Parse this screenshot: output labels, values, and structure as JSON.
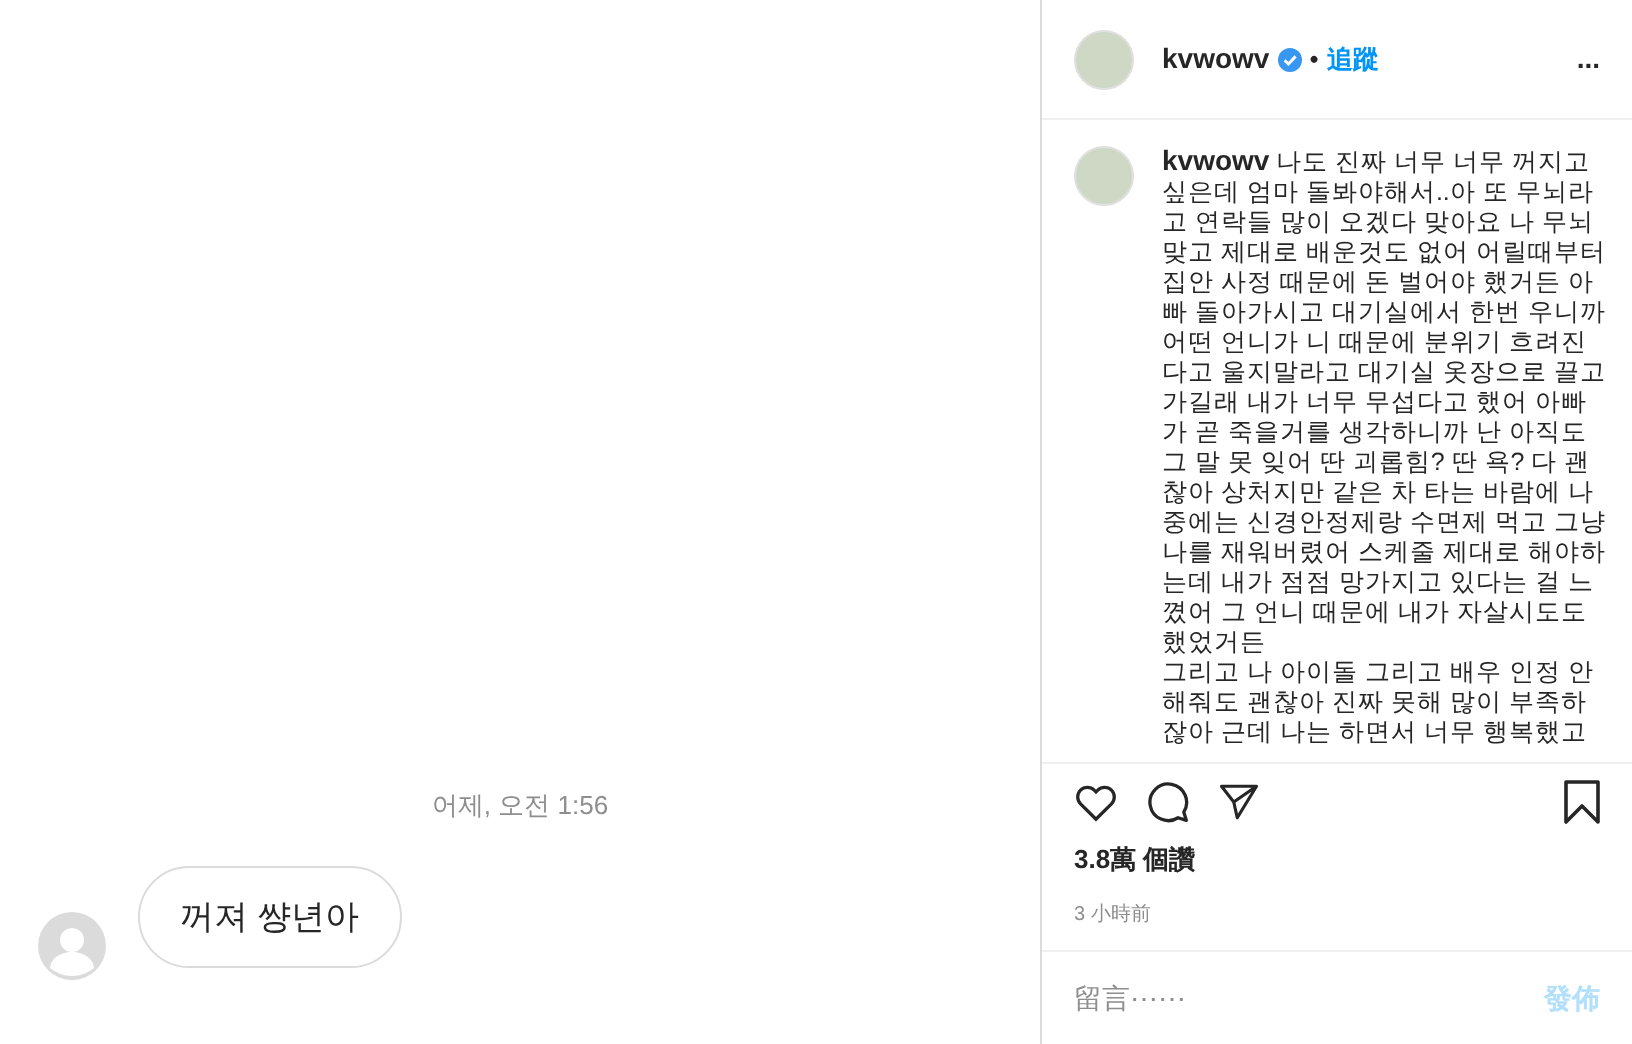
{
  "chat": {
    "timestamp": "어제, 오전 1:56",
    "messages": [
      {
        "text": "꺼져 썅년아"
      }
    ]
  },
  "post": {
    "username": "kvwowv",
    "verified": true,
    "separator": "•",
    "follow": "追蹤",
    "more": "...",
    "caption": {
      "username": "kvwowv",
      "lines": [
        "나도 진짜 너무 너무 꺼지고",
        "싶은데 엄마 돌봐야해서..아 또 무뇌라",
        "고 연락들 많이 오겠다 맞아요 나 무뇌",
        "맞고 제대로 배운것도 없어 어릴때부터",
        "집안 사정 때문에 돈 벌어야 했거든 아",
        "빠 돌아가시고 대기실에서 한번 우니까",
        "어떤 언니가 니 때문에 분위기 흐려진",
        "다고 울지말라고 대기실 옷장으로 끌고",
        "가길래 내가 너무 무섭다고 했어 아빠",
        "가 곧 죽을거를 생각하니까 난 아직도",
        "그 말 못 잊어 딴 괴롭힘? 딴 욕? 다 괜",
        "찮아 상처지만 같은 차 타는 바람에 나",
        "중에는 신경안정제랑 수면제 먹고 그냥",
        "나를 재워버렸어 스케줄 제대로 해야하",
        "는데 내가 점점 망가지고 있다는 걸 느",
        "꼈어 그 언니 때문에 내가 자살시도도",
        "했었거든",
        "그리고 나 아이돌 그리고 배우 인정 안",
        "해줘도 괜찮아 진짜 못해 많이 부족하",
        "잖아 근데 나는 하면서 너무 행복했고"
      ]
    },
    "likes": "3.8萬 個讚",
    "time": "3 小時前",
    "comment": {
      "placeholder": "留言⋯⋯",
      "post_button": "發佈"
    }
  }
}
